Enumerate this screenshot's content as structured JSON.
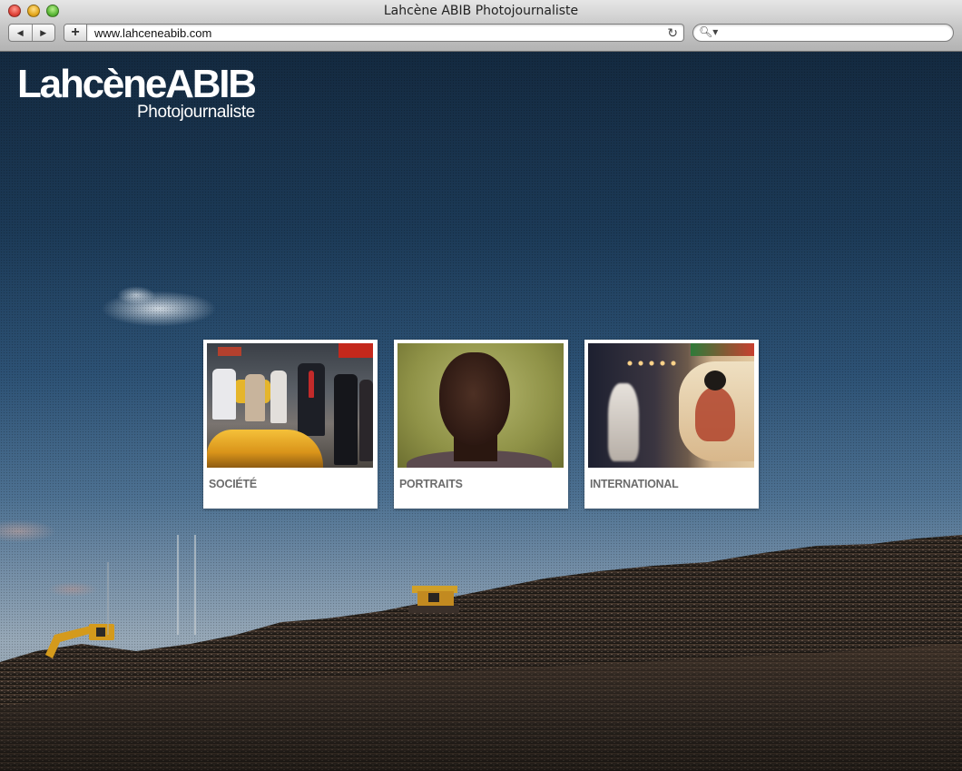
{
  "window": {
    "title": "Lahcène ABIB Photojournaliste"
  },
  "toolbar": {
    "back_icon": "back-arrow-icon",
    "forward_icon": "forward-arrow-icon",
    "add_label": "+",
    "url": "www.lahceneabib.com",
    "search_placeholder": ""
  },
  "site": {
    "logo_main": "LahcèneABIB",
    "logo_sub": "Photojournaliste"
  },
  "galleries": [
    {
      "label": "SOCIÉTÉ"
    },
    {
      "label": "PORTRAITS"
    },
    {
      "label": "INTERNATIONAL"
    }
  ],
  "colors": {
    "sky_top": "#142a40",
    "sky_horizon": "#98a9b8",
    "card_bg": "#ffffff",
    "card_label": "#6b6b6b"
  }
}
